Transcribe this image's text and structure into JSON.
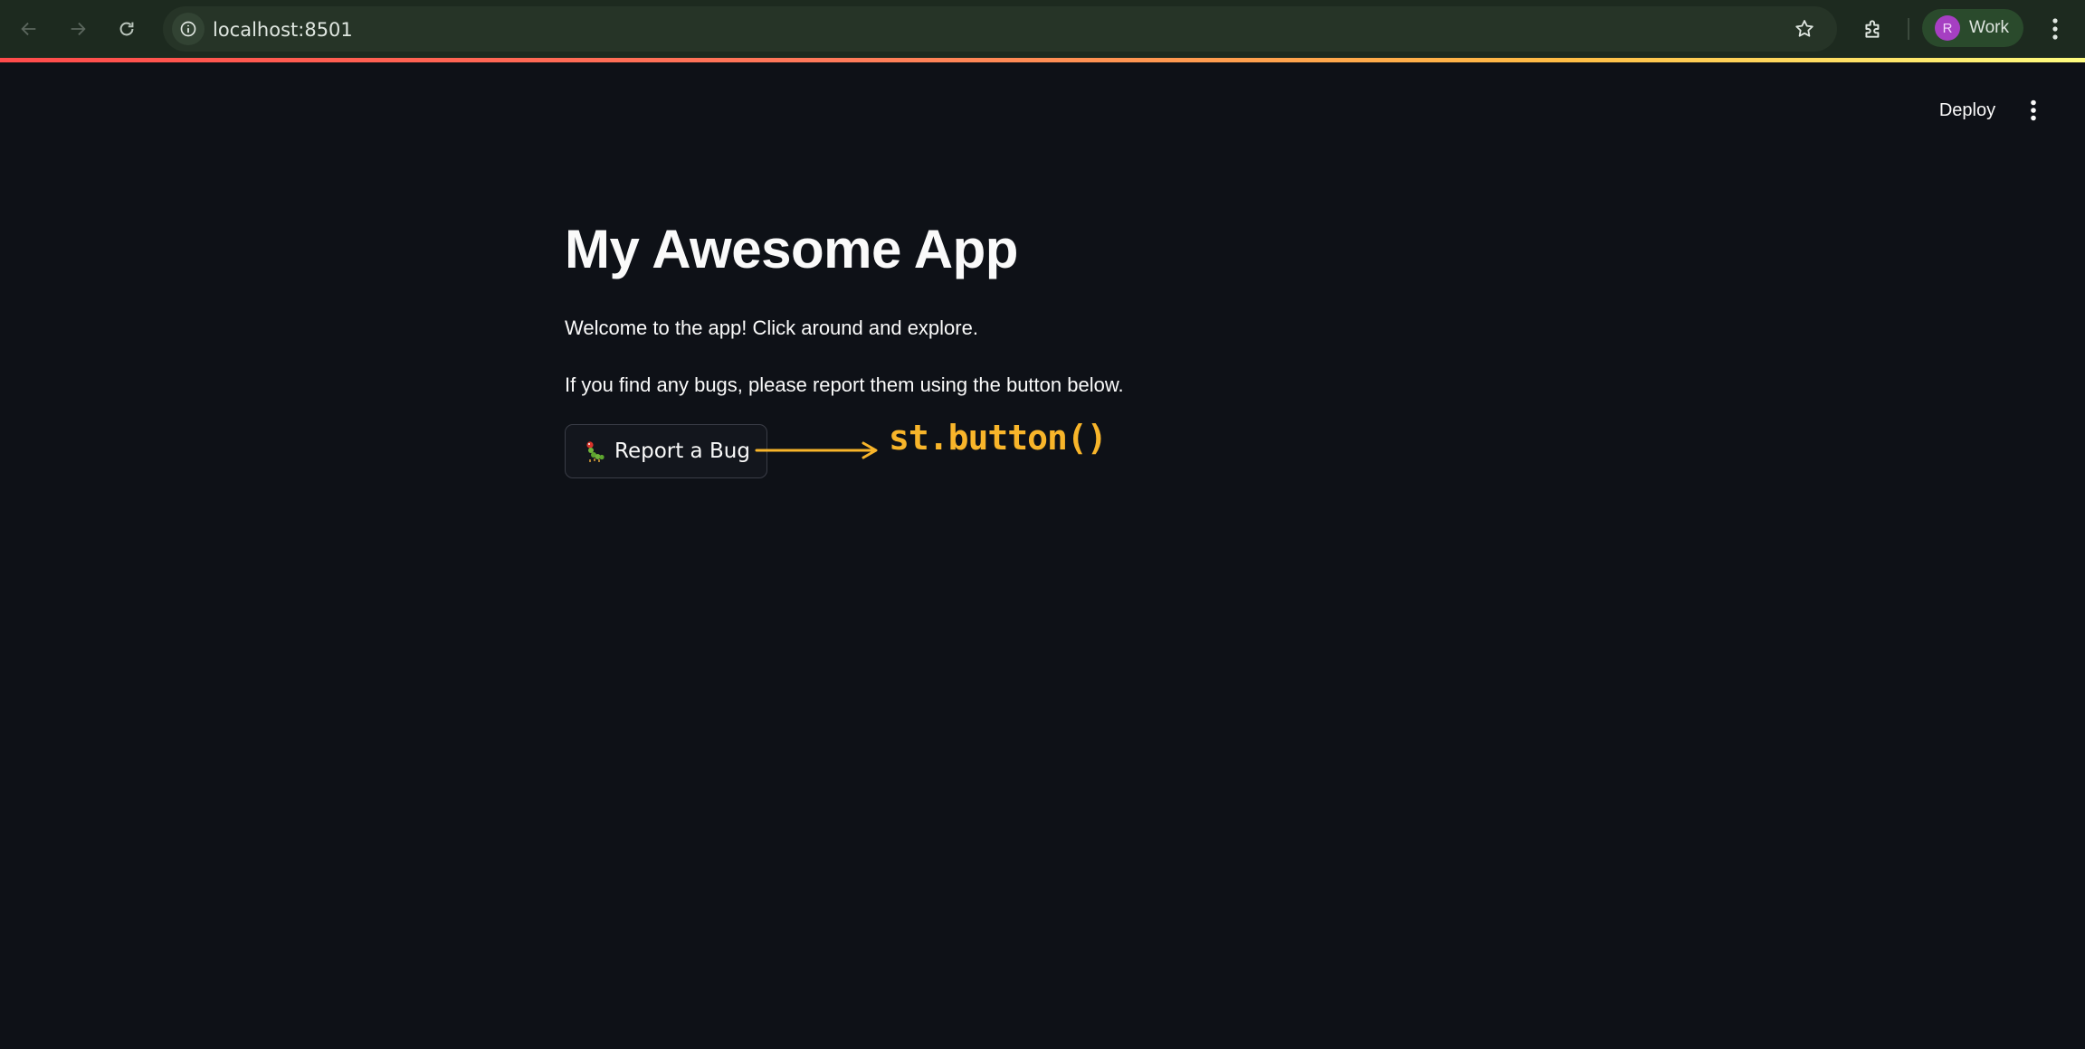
{
  "browser": {
    "url": "localhost:8501",
    "profile_initial": "R",
    "profile_label": "Work",
    "gradient_colors": [
      "#ff4b4b",
      "#ffbd45",
      "#fffd80"
    ]
  },
  "header": {
    "deploy_label": "Deploy"
  },
  "main": {
    "title": "My Awesome App",
    "paragraph_1": "Welcome to the app! Click around and explore.",
    "paragraph_2": "If you find any bugs, please report them using the button below.",
    "bug_button_label": "Report a Bug",
    "bug_button_icon": "bug-icon"
  },
  "annotation": {
    "text": "st.button()",
    "color": "#f8b52a"
  }
}
